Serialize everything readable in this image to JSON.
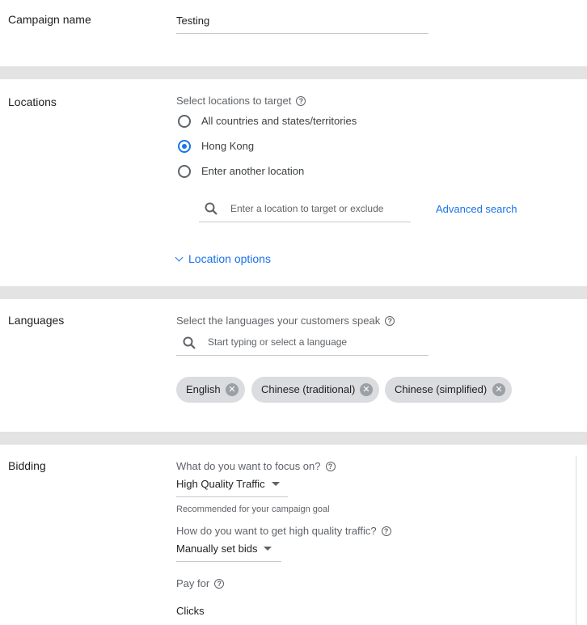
{
  "campaign": {
    "label": "Campaign name",
    "value": "Testing"
  },
  "locations": {
    "label": "Locations",
    "prompt": "Select locations to target",
    "options": [
      {
        "label": "All countries and states/territories",
        "selected": false
      },
      {
        "label": "Hong Kong",
        "selected": true
      },
      {
        "label": "Enter another location",
        "selected": false
      }
    ],
    "search_placeholder": "Enter a location to target or exclude",
    "advanced_search": "Advanced search",
    "location_options": "Location options"
  },
  "languages": {
    "label": "Languages",
    "prompt": "Select the languages your customers speak",
    "search_placeholder": "Start typing or select a language",
    "chips": [
      "English",
      "Chinese (traditional)",
      "Chinese (simplified)"
    ]
  },
  "bidding": {
    "label": "Bidding",
    "focus_prompt": "What do you want to focus on?",
    "focus_value": "High Quality Traffic",
    "recommended_note": "Recommended for your campaign goal",
    "traffic_prompt": "How do you want to get high quality traffic?",
    "traffic_value": "Manually set bids",
    "pay_for_label": "Pay for",
    "pay_for_value": "Clicks"
  },
  "colors": {
    "accent": "#1a73e8",
    "chip": "#dadce0",
    "text": "#202124",
    "muted": "#5f6368"
  }
}
